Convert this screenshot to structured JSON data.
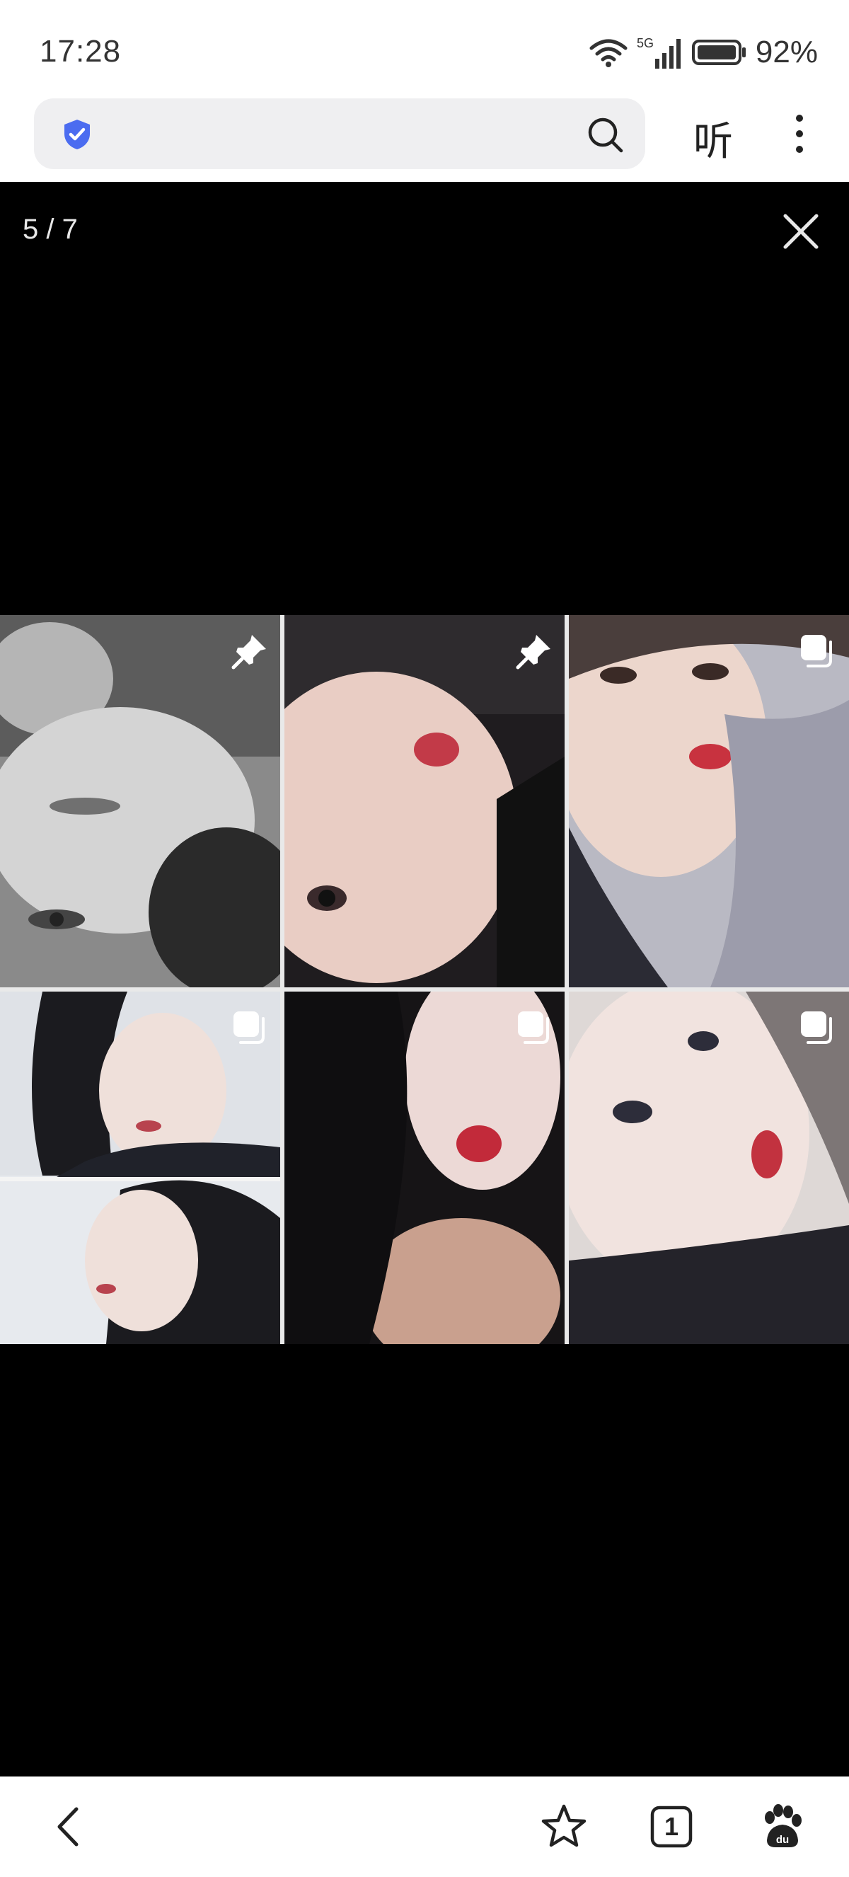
{
  "status": {
    "time": "17:28",
    "network": "5G",
    "battery": "92%",
    "icons": [
      "wifi-icon",
      "signal-icon",
      "battery-icon"
    ]
  },
  "browser": {
    "security_icon": "shield-check-icon",
    "url": "",
    "listen_label": "听",
    "icons": [
      "search-icon",
      "more-vertical-icon"
    ]
  },
  "viewer": {
    "counter": "5 / 7",
    "close_icon": "close-icon",
    "image_caption": "",
    "grid": [
      {
        "name": "photo-1",
        "badge": "pin-icon",
        "tone": "grayscale"
      },
      {
        "name": "photo-2",
        "badge": "pin-icon",
        "tone": "warm"
      },
      {
        "name": "photo-3",
        "badge": "multi-image-icon",
        "tone": "warm"
      },
      {
        "name": "photo-4",
        "badge": "multi-image-icon",
        "tone": "snow"
      },
      {
        "name": "photo-5",
        "badge": "multi-image-icon",
        "tone": "dark"
      },
      {
        "name": "photo-6",
        "badge": "multi-image-icon",
        "tone": "warm"
      }
    ]
  },
  "bottom_nav": {
    "tab_count": "1",
    "icons": [
      "back-icon",
      "star-icon",
      "tabs-icon",
      "baidu-paw-icon"
    ]
  },
  "colors": {
    "accent": "#4b6cf0",
    "viewer_bg": "#000000",
    "bar_bg": "#ffffff"
  }
}
